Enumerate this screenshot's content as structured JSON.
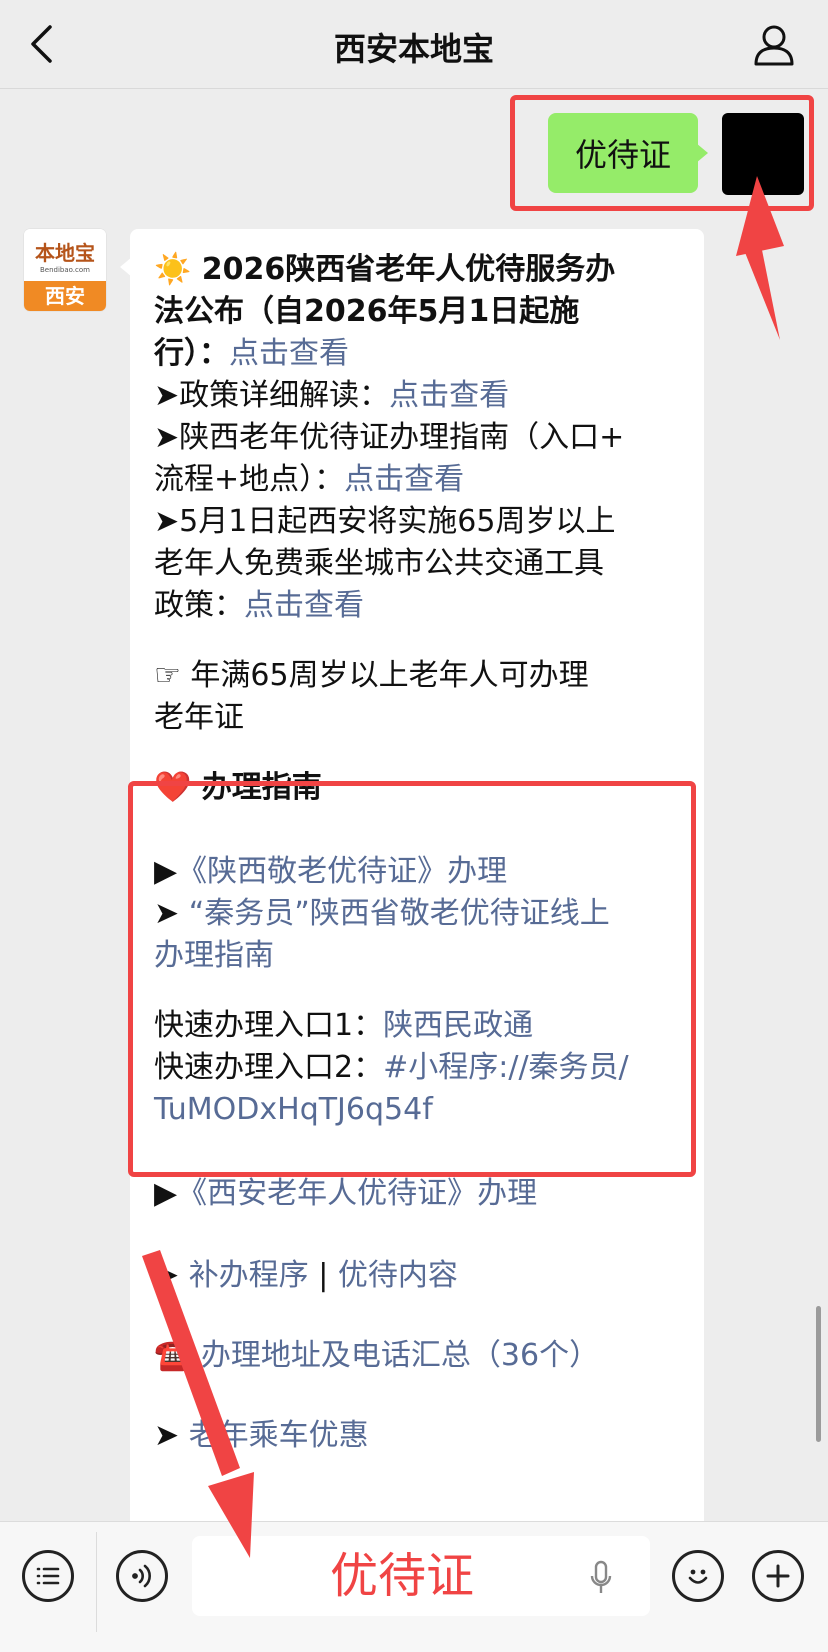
{
  "nav": {
    "title": "西安本地宝",
    "back_icon": "chevron-left-icon",
    "profile_icon": "person-icon"
  },
  "sent_message": {
    "text": "优待证"
  },
  "avatar": {
    "logo": "本地宝",
    "sub": "Bendibao.com",
    "city": "西安"
  },
  "received": {
    "lines": [
      {
        "parts": [
          {
            "text": "☀️ 2026陕西省老年人优待服务办",
            "bold": true
          }
        ]
      },
      {
        "parts": [
          {
            "text": "法公布（自2026年5月1日起施",
            "bold": true
          }
        ]
      },
      {
        "parts": [
          {
            "text": "行）：",
            "bold": true
          },
          {
            "text": "点击查看",
            "link": true
          }
        ]
      },
      {
        "parts": [
          {
            "text": "➤政策详细解读："
          },
          {
            "text": "点击查看",
            "link": true
          }
        ]
      },
      {
        "parts": [
          {
            "text": "➤陕西老年优待证办理指南（入口+"
          }
        ]
      },
      {
        "parts": [
          {
            "text": "流程+地点）："
          },
          {
            "text": "点击查看",
            "link": true
          }
        ]
      },
      {
        "parts": [
          {
            "text": "➤5月1日起西安将实施65周岁以上"
          }
        ]
      },
      {
        "parts": [
          {
            "text": "老年人免费乘坐城市公共交通工具"
          }
        ]
      },
      {
        "parts": [
          {
            "text": "政策："
          },
          {
            "text": "点击查看",
            "link": true
          }
        ]
      },
      {
        "parts": [
          {
            "text": ""
          }
        ]
      },
      {
        "parts": [
          {
            "text": "☞ 年满65周岁以上老年人可办理"
          }
        ]
      },
      {
        "parts": [
          {
            "text": "老年证"
          }
        ]
      },
      {
        "parts": [
          {
            "text": ""
          }
        ]
      },
      {
        "parts": [
          {
            "text": "❤️ 办理指南",
            "bold": true
          }
        ]
      },
      {
        "parts": [
          {
            "text": ""
          }
        ]
      },
      {
        "parts": [
          {
            "text": "▶"
          },
          {
            "text": "《陕西敬老优待证》办理",
            "link": true
          }
        ]
      },
      {
        "parts": [
          {
            "text": "➤ "
          },
          {
            "text": "“秦务员”陕西省敬老优待证线上",
            "link": true
          }
        ]
      },
      {
        "parts": [
          {
            "text": "办理指南",
            "link": true
          }
        ]
      },
      {
        "parts": [
          {
            "text": ""
          }
        ]
      },
      {
        "parts": [
          {
            "text": "快速办理入口1："
          },
          {
            "text": "陕西民政通",
            "link": true
          }
        ]
      },
      {
        "parts": [
          {
            "text": "快速办理入口2："
          },
          {
            "text": "#小程序://秦务员/",
            "link": true
          }
        ]
      },
      {
        "parts": [
          {
            "text": "TuMODxHqTJ6q54f",
            "link": true
          }
        ]
      },
      {
        "parts": [
          {
            "text": ""
          }
        ]
      },
      {
        "parts": [
          {
            "text": "▶"
          },
          {
            "text": "《西安老年人优待证》办理",
            "link": true
          }
        ]
      },
      {
        "parts": [
          {
            "text": ""
          }
        ]
      },
      {
        "parts": [
          {
            "text": "➤ "
          },
          {
            "text": "补办程序",
            "link": true
          },
          {
            "text": " | "
          },
          {
            "text": "优待内容",
            "link": true
          }
        ]
      },
      {
        "parts": [
          {
            "text": ""
          }
        ]
      },
      {
        "parts": [
          {
            "text": "☎️ "
          },
          {
            "text": "办理地址及电话汇总（36个）",
            "link": true
          }
        ]
      },
      {
        "parts": [
          {
            "text": ""
          }
        ]
      },
      {
        "parts": [
          {
            "text": "➤ "
          },
          {
            "text": "老年乘车优惠",
            "link": true
          }
        ]
      }
    ]
  },
  "toolbar": {
    "menu_icon": "list-menu-icon",
    "voice_icon": "voice-wave-icon",
    "input_value": "优待证",
    "mic_icon": "microphone-icon",
    "emoji_icon": "smiley-icon",
    "add_icon": "plus-icon"
  },
  "colors": {
    "accent_red": "#f04444",
    "link": "#576b95",
    "bubble_green": "#95ec69"
  }
}
